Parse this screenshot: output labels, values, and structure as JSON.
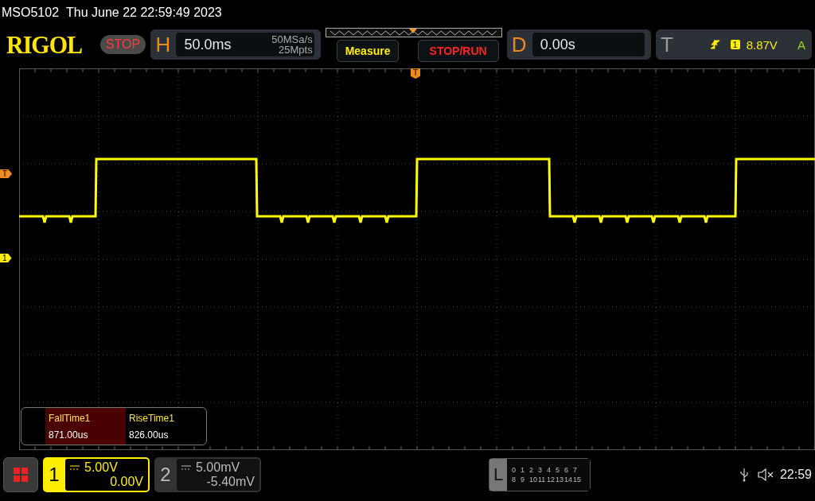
{
  "status_bar": {
    "model": "MSO5102",
    "datetime": "Thu June 22 22:59:49 2023"
  },
  "toolbar": {
    "logo": "RIGOL",
    "run_state": "STOP",
    "horizontal": {
      "label": "H",
      "timebase": "50.0ms",
      "sample_rate": "50MSa/s",
      "memory_depth": "25Mpts"
    },
    "buttons": [
      {
        "label": "Measure",
        "kind": "measure"
      },
      {
        "label": "STOP/RUN",
        "kind": "stoprun"
      }
    ],
    "delay": {
      "label": "D",
      "value": "0.00s"
    },
    "trigger": {
      "label": "T",
      "source": "1",
      "trigger_level": "8.87V",
      "mode": "A"
    }
  },
  "display": {
    "trigger_marker": "T",
    "channel_marker": "1",
    "trigger_position_marker": "T"
  },
  "measurements": [
    {
      "name": "FallTime1",
      "value": "871.00us",
      "selected": true
    },
    {
      "name": "RiseTime1",
      "value": "826.00us",
      "selected": false
    }
  ],
  "channels": [
    {
      "number": "1",
      "scale": "5.00V",
      "offset": "0.00V",
      "selected": true
    },
    {
      "number": "2",
      "scale": "5.00mV",
      "offset": "-5.40mV",
      "selected": false
    }
  ],
  "logic": {
    "label": "L",
    "rows": [
      [
        "0",
        "1",
        "2",
        "3",
        "4",
        "5",
        "6",
        "7"
      ],
      [
        "8",
        "9",
        "10",
        "11",
        "12",
        "13",
        "14",
        "15"
      ]
    ]
  },
  "system": {
    "time": "22:59",
    "muted": true
  }
}
